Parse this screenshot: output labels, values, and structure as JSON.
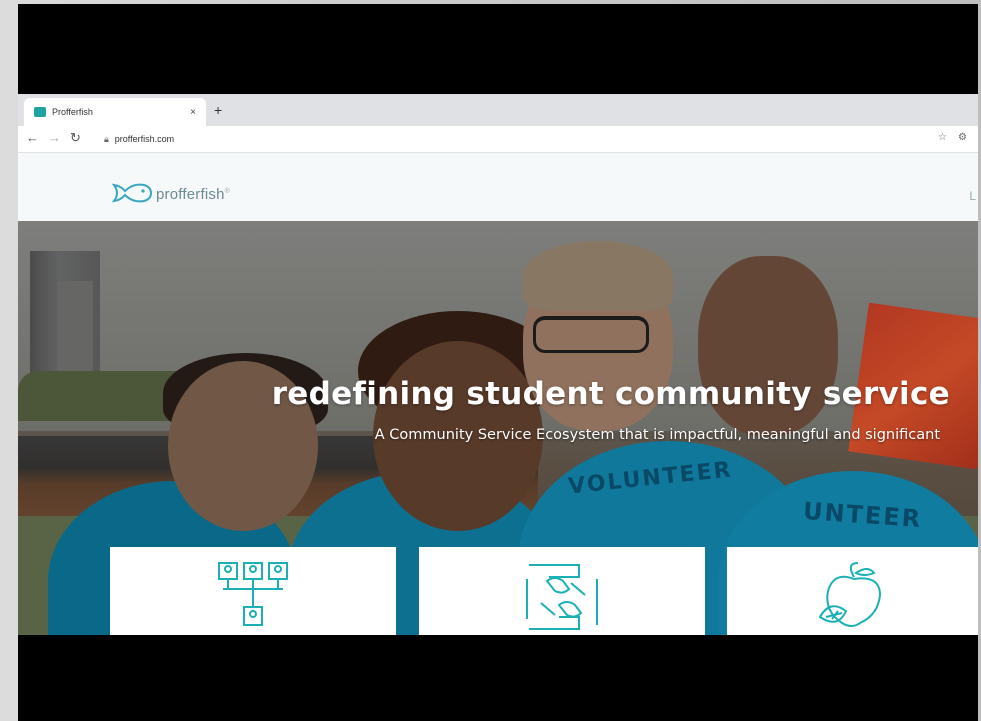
{
  "browser": {
    "tab_title": "Profferfish",
    "tab_close": "×",
    "new_tab": "+",
    "url": "profferfish.com",
    "accent": "#1fa3a0"
  },
  "site": {
    "brand": "profferfish",
    "brand_mark": "®",
    "header_right_partial": "L"
  },
  "hero": {
    "headline": "redefining student community service",
    "subheadline": "A Community Service Ecosystem that is impactful, meaningful and significant",
    "shirt_text_1": "VOLUNTEER",
    "shirt_text_2": "UNTEER"
  },
  "cards": [
    {
      "icon": "org-chart-icon"
    },
    {
      "icon": "teamwork-hands-icon"
    },
    {
      "icon": "apple-icon"
    }
  ]
}
